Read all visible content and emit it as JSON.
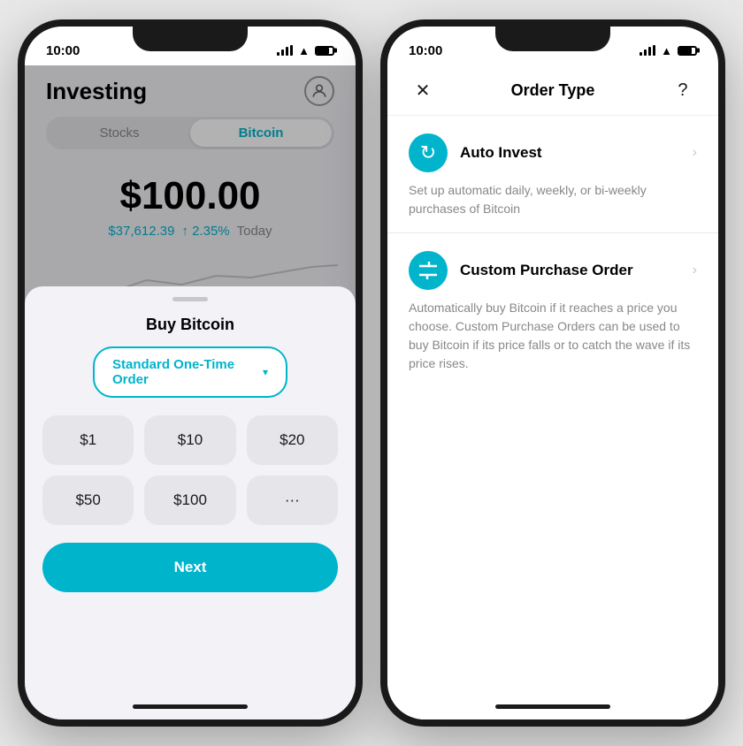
{
  "left_phone": {
    "status_bar": {
      "time": "10:00"
    },
    "header": {
      "title": "Investing"
    },
    "tabs": {
      "items": [
        "Stocks",
        "Bitcoin"
      ],
      "active": "Bitcoin"
    },
    "price": {
      "main": "$100.00",
      "usd": "$37,612.39",
      "change": "↑ 2.35%",
      "period": "Today"
    },
    "bottom_sheet": {
      "title": "Buy Bitcoin",
      "order_type": "Standard One-Time Order",
      "amounts": [
        "$1",
        "$10",
        "$20",
        "$50",
        "$100",
        "···"
      ],
      "next_button": "Next"
    }
  },
  "right_phone": {
    "status_bar": {
      "time": "10:00"
    },
    "header": {
      "title": "Order Type",
      "close": "✕",
      "help": "?"
    },
    "options": [
      {
        "id": "auto-invest",
        "icon": "↻",
        "title": "Auto Invest",
        "description": "Set up automatic daily, weekly, or bi-weekly purchases of Bitcoin"
      },
      {
        "id": "custom-purchase",
        "icon": "⤢",
        "title": "Custom Purchase Order",
        "description": "Automatically buy Bitcoin if it reaches a price you choose. Custom Purchase Orders can be used to buy Bitcoin if its price falls or to catch the wave if its price rises."
      }
    ]
  }
}
